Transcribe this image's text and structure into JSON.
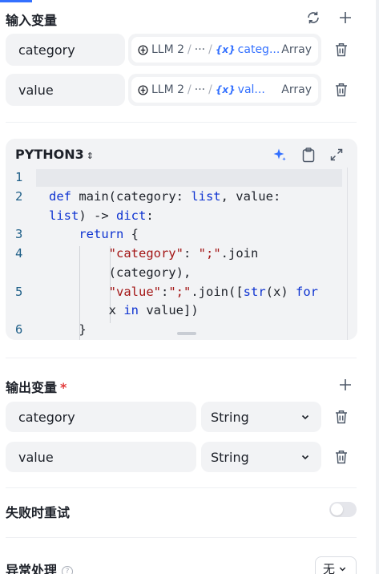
{
  "input_section": {
    "title": "输入变量",
    "rows": [
      {
        "name": "category",
        "ref_node": "LLM 2",
        "ref_ellipsis": "···",
        "ref_var": "categ...",
        "ref_type": "Array"
      },
      {
        "name": "value",
        "ref_node": "LLM 2",
        "ref_ellipsis": "···",
        "ref_var": "val...",
        "ref_type": "Array"
      }
    ]
  },
  "editor": {
    "language": "PYTHON3",
    "gutter": [
      "1",
      "2",
      "3",
      "4",
      "5",
      "6"
    ]
  },
  "output_section": {
    "title": "输出变量",
    "required_mark": "*",
    "rows": [
      {
        "name": "category",
        "type": "String"
      },
      {
        "name": "value",
        "type": "String"
      }
    ]
  },
  "retry": {
    "label": "失败时重试",
    "enabled": false
  },
  "error_handling": {
    "label": "异常处理",
    "value": "无"
  },
  "colors": {
    "accent": "#3370ff",
    "keyword": "#0e33d1",
    "string": "#a31515",
    "required": "#e23b3b"
  },
  "icons": [
    "refresh-icon",
    "plus-icon",
    "trash-icon",
    "sparkle-icon",
    "clipboard-icon",
    "expand-icon",
    "chevron-down-icon",
    "help-icon"
  ]
}
